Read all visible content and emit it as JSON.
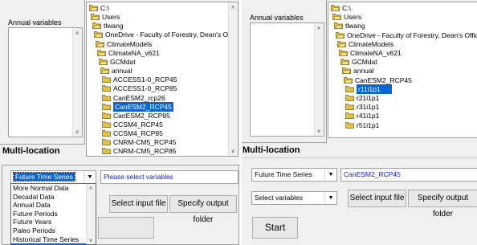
{
  "colors": {
    "selection": "#0a64d2",
    "folder": "#e3c24a",
    "link_text": "#1020d0"
  },
  "left": {
    "annual_variables_label": "Annual variables",
    "multi_location_heading": "Multi-location",
    "tree_nodes": [
      "C:\\",
      "Users",
      "tlwang",
      "OneDrive - Faculty of Forestry, Dean's Office",
      "ClimateModels",
      "ClimateNA_v621",
      "GCMdat",
      "annual",
      "ACCESS1-0_RCP45",
      "ACCESS1-0_RCP85",
      "CanESM2_rcp26",
      "CanESM2_RCP45",
      "CanESM2_RCP85",
      "CCSM4_RCP45",
      "CCSM4_RCP85",
      "CNRM-CM5_RCP45",
      "CNRM-CM5_RCP85"
    ],
    "period_select": {
      "value": "Future Time Series",
      "icon": "chevron-down-icon"
    },
    "variables_hint": "Please select variables",
    "period_options": [
      "More Normal Data",
      "Decadal Data",
      "Annual Data",
      "Future Periods",
      "Future Years",
      "Paleo Periods",
      "Historical Time Series",
      "Future Time Series"
    ],
    "select_input_button": "Select input file",
    "output_folder_button": "Specify output folder"
  },
  "right": {
    "annual_variables_label": "Annual variables",
    "multi_location_heading": "Multi-location",
    "tree_nodes": [
      "C:\\",
      "Users",
      "tlwang",
      "OneDrive - Faculty of Forestry, Dean's Office",
      "ClimateModels",
      "ClimateNA_v621",
      "GCMdat",
      "annual",
      "CanESM2_RCP45",
      "r11i1p1",
      "r21i1p1",
      "r31i1p1",
      "r41i1p1",
      "r51i1p1"
    ],
    "period_select": {
      "value": "Future Time Series"
    },
    "model_text": "CanESM2_RCP45",
    "variables_select": {
      "value": "Select variables"
    },
    "select_input_button": "Select input file",
    "output_folder_button": "Specify output folder",
    "start_button": "Start"
  }
}
